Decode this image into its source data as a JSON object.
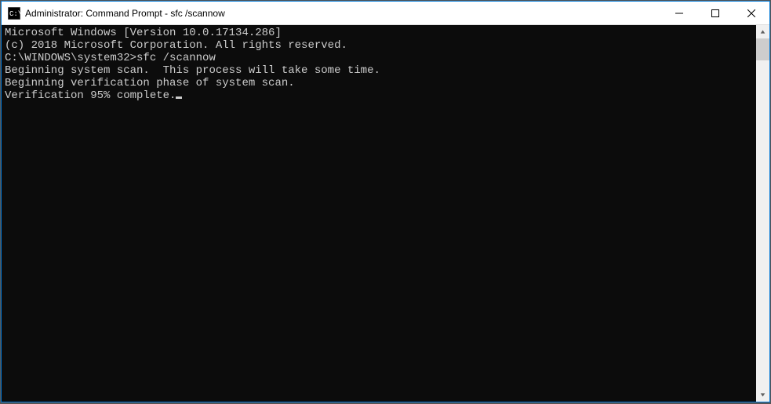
{
  "titlebar": {
    "title": "Administrator: Command Prompt - sfc  /scannow"
  },
  "console": {
    "line1": "Microsoft Windows [Version 10.0.17134.286]",
    "line2": "(c) 2018 Microsoft Corporation. All rights reserved.",
    "blank1": "",
    "prompt_path": "C:\\WINDOWS\\system32>",
    "prompt_command": "sfc /scannow",
    "blank2": "",
    "line4": "Beginning system scan.  This process will take some time.",
    "blank3": "",
    "line5": "Beginning verification phase of system scan.",
    "line6": "Verification 95% complete."
  }
}
